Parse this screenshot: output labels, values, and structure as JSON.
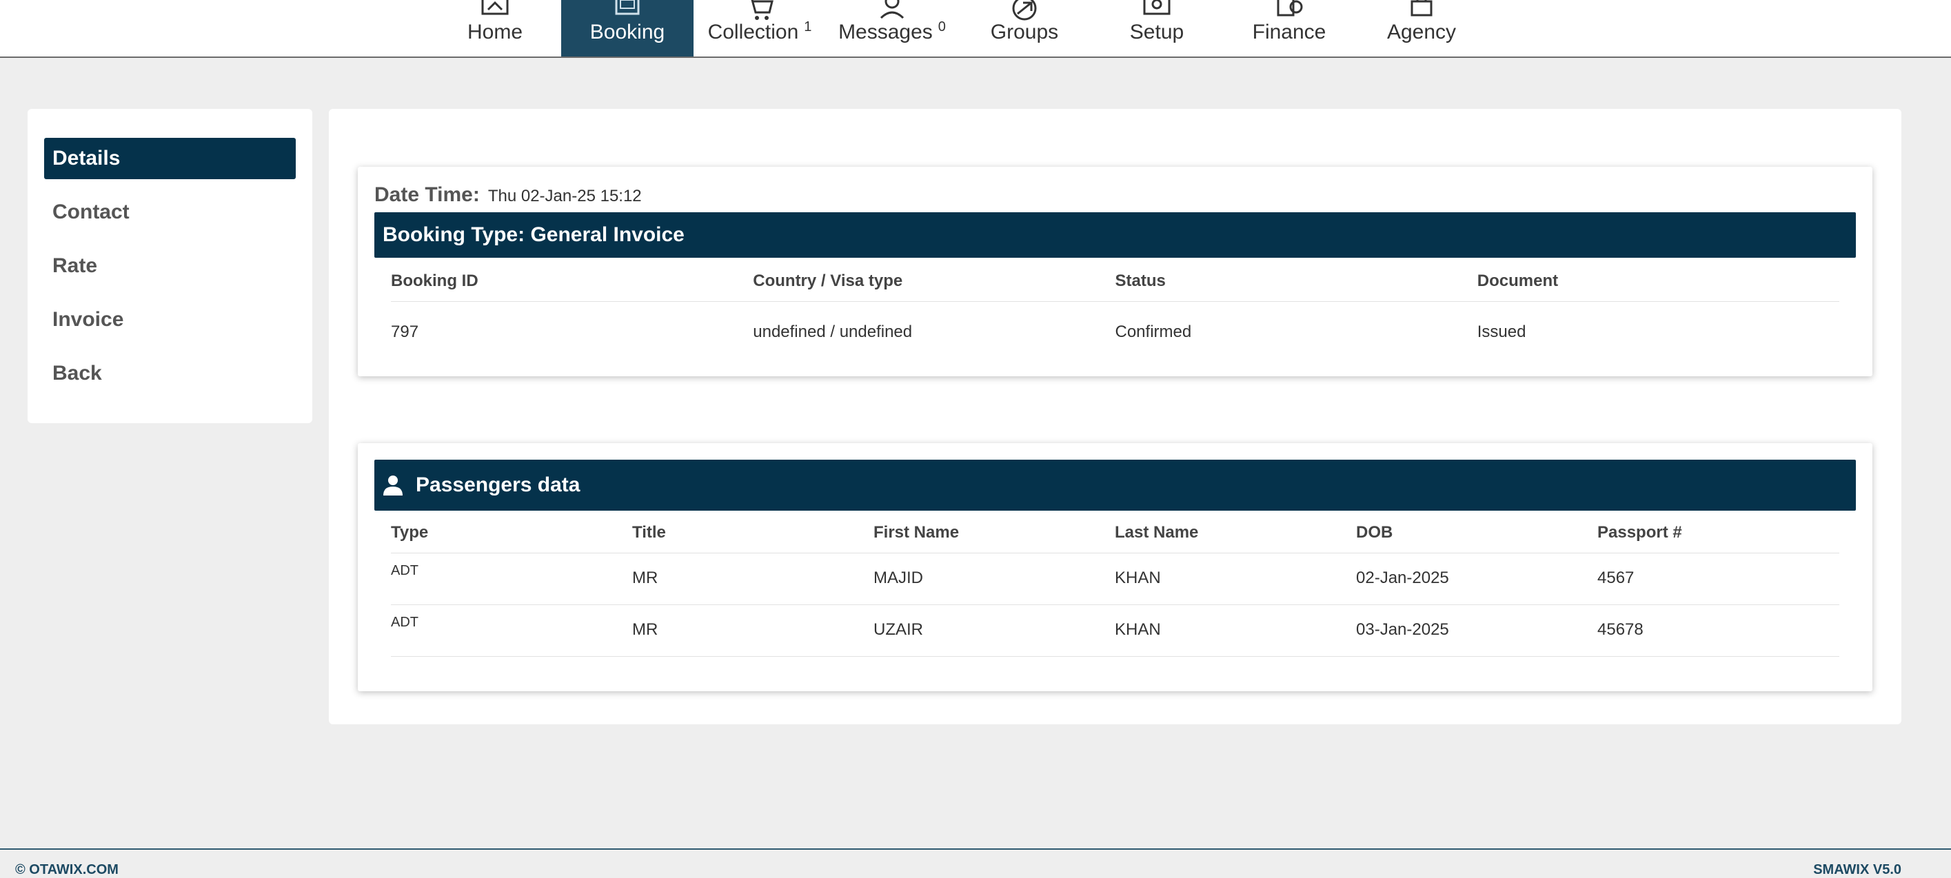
{
  "nav": {
    "items": [
      {
        "label": "Home",
        "icon": "home-icon"
      },
      {
        "label": "Booking",
        "icon": "booking-icon",
        "active": true
      },
      {
        "label": "Collection",
        "icon": "cart-icon",
        "count": "1"
      },
      {
        "label": "Messages",
        "icon": "user-icon",
        "count": "0"
      },
      {
        "label": "Groups",
        "icon": "plane-icon"
      },
      {
        "label": "Setup",
        "icon": "gear-icon"
      },
      {
        "label": "Finance",
        "icon": "finance-icon"
      },
      {
        "label": "Agency",
        "icon": "agency-icon"
      }
    ]
  },
  "sidebar": {
    "items": [
      {
        "label": "Details",
        "active": true
      },
      {
        "label": "Contact"
      },
      {
        "label": "Rate"
      },
      {
        "label": "Invoice"
      },
      {
        "label": "Back"
      }
    ]
  },
  "booking": {
    "date_time_label": "Date Time:",
    "date_time_value": "Thu 02-Jan-25 15:12",
    "type_title": "Booking Type: General Invoice",
    "headers": [
      "Booking ID",
      "Country / Visa type",
      "Status",
      "Document"
    ],
    "row": [
      "797",
      "undefined / undefined",
      "Confirmed",
      "Issued"
    ]
  },
  "passengers": {
    "title": "Passengers data",
    "headers": [
      "Type",
      "Title",
      "First Name",
      "Last Name",
      "DOB",
      "Passport #"
    ],
    "rows": [
      [
        "ADT",
        "MR",
        "MAJID",
        "KHAN",
        "02-Jan-2025",
        "4567"
      ],
      [
        "ADT",
        "MR",
        "UZAIR",
        "KHAN",
        "03-Jan-2025",
        "45678"
      ]
    ]
  },
  "footer": {
    "left": "© OTAWIX.COM",
    "right": "SMAWIX V5.0"
  },
  "colors": {
    "primary": "#05324b",
    "nav_active": "#1d4a63",
    "background": "#eeeeee"
  }
}
